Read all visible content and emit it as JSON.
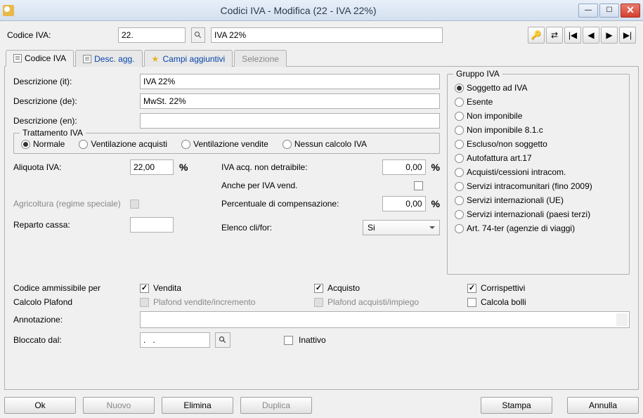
{
  "titlebar": {
    "title": "Codici IVA - Modifica (22 - IVA 22%)"
  },
  "top": {
    "label": "Codice IVA:",
    "code_value": "22.",
    "desc_value": "IVA 22%"
  },
  "tabs": {
    "0": {
      "label": "Codice IVA"
    },
    "1": {
      "label": "Desc. agg."
    },
    "2": {
      "label": "Campi aggiuntivi"
    },
    "3": {
      "label": "Selezione"
    }
  },
  "desc": {
    "it_label": "Descrizione (it):",
    "it_value": "IVA 22%",
    "de_label": "Descrizione (de):",
    "de_value": "MwSt. 22%",
    "en_label": "Descrizione (en):",
    "en_value": ""
  },
  "tratt": {
    "legend": "Trattamento IVA",
    "options": {
      "0": "Normale",
      "1": "Ventilazione acquisti",
      "2": "Ventilazione vendite",
      "3": "Nessun calcolo IVA"
    }
  },
  "aliq": {
    "label": "Aliquota IVA:",
    "value": "22,00",
    "iva_acq_label": "IVA acq. non detraibile:",
    "iva_acq_value": "0,00",
    "anche_label": "Anche per IVA vend.",
    "agric_label": "Agricoltura (regime speciale)",
    "perc_label": "Percentuale di compensazione:",
    "perc_value": "0,00",
    "reparto_label": "Reparto cassa:",
    "reparto_value": "",
    "elenco_label": "Elenco cli/for:",
    "elenco_value": "Si"
  },
  "gruppo": {
    "legend": "Gruppo IVA",
    "options": {
      "0": "Soggetto ad IVA",
      "1": "Esente",
      "2": "Non imponibile",
      "3": "Non imponibile 8.1.c",
      "4": "Escluso/non soggetto",
      "5": "Autofattura art.17",
      "6": "Acquisti/cessioni intracom.",
      "7": "Servizi intracomunitari (fino 2009)",
      "8": "Servizi internazionali (UE)",
      "9": "Servizi internazionali (paesi terzi)",
      "10": "Art. 74-ter (agenzie di viaggi)"
    }
  },
  "cod_amm": {
    "label": "Codice ammissibile per",
    "vendita": "Vendita",
    "acquisto": "Acquisto",
    "corrispettivi": "Corrispettivi"
  },
  "plafond": {
    "label": "Calcolo Plafond",
    "vendite": "Plafond vendite/incremento",
    "acquisti": "Plafond acquisti/impiego",
    "bolli": "Calcola bolli"
  },
  "annot": {
    "label": "Annotazione:"
  },
  "bloc": {
    "label": "Bloccato dal:",
    "value": ".   .",
    "inattivo": "Inattivo"
  },
  "btns": {
    "ok": "Ok",
    "nuovo": "Nuovo",
    "elimina": "Elimina",
    "duplica": "Duplica",
    "stampa": "Stampa",
    "annulla": "Annulla"
  }
}
